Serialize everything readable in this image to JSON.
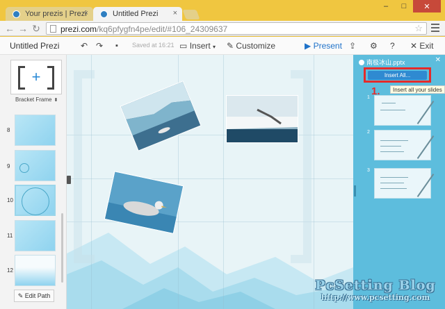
{
  "browser": {
    "tabs": [
      {
        "label": "Your prezis | Prezi",
        "close": "×"
      },
      {
        "label": "Untitled Prezi",
        "close": "×"
      }
    ],
    "window_controls": {
      "minimize": "–",
      "maximize": "□",
      "close": "✕"
    },
    "url": "prezi.com/kq6pfygfn4pe/edit/#106_24309637",
    "url_host": "prezi.com",
    "url_path": "/kq6pfygfn4pe/edit/#106_24309637"
  },
  "toolbar": {
    "title": "Untitled Prezi",
    "saved": "Saved at 16:21",
    "insert": "Insert",
    "customize": "Customize",
    "present": "Present",
    "exit": "Exit"
  },
  "sidebar": {
    "frame_label": "Bracket Frame",
    "slides": [
      {
        "num": "8"
      },
      {
        "num": "9"
      },
      {
        "num": "10"
      },
      {
        "num": "11"
      },
      {
        "num": "12"
      }
    ],
    "edit_path": "Edit Path"
  },
  "right_panel": {
    "file_name": "南极冰山.pptx",
    "insert_all": "Insert All...",
    "tooltip": "Insert all your slides",
    "annotation": "1.",
    "slides": [
      {
        "num": "1"
      },
      {
        "num": "2"
      },
      {
        "num": "3"
      }
    ]
  },
  "watermark": {
    "title": "PcSetting Blog",
    "url": "http://www.pcsetting.com"
  },
  "colors": {
    "accent": "#1f72c9",
    "panel": "#5dbddd",
    "highlight": "#e52a2a"
  }
}
